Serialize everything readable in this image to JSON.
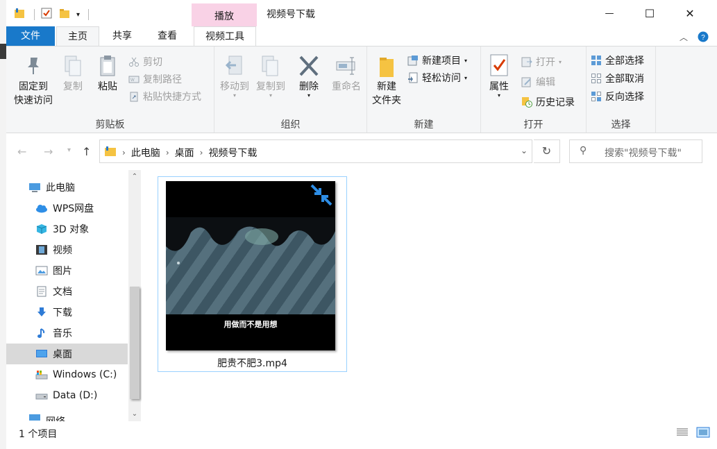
{
  "window": {
    "title": "视频号下载",
    "context_tab_group": "播放",
    "controls": {
      "minimize": "—",
      "maximize": "☐",
      "close": "✕"
    }
  },
  "ribbon_tabs": {
    "file": "文件",
    "home": "主页",
    "share": "共享",
    "view": "查看",
    "video_tools": "视频工具"
  },
  "ribbon": {
    "clipboard": {
      "label": "剪贴板",
      "pin_line1": "固定到",
      "pin_line2": "快速访问",
      "copy": "复制",
      "paste": "粘贴",
      "cut": "剪切",
      "copy_path": "复制路径",
      "paste_shortcut": "粘贴快捷方式"
    },
    "organize": {
      "label": "组织",
      "move_to": "移动到",
      "copy_to": "复制到",
      "delete": "删除",
      "rename": "重命名"
    },
    "new": {
      "label": "新建",
      "new_folder_line1": "新建",
      "new_folder_line2": "文件夹",
      "new_item": "新建项目",
      "easy_access": "轻松访问"
    },
    "open": {
      "label": "打开",
      "properties": "属性",
      "open": "打开",
      "edit": "编辑",
      "history": "历史记录"
    },
    "select": {
      "label": "选择",
      "select_all": "全部选择",
      "select_none": "全部取消",
      "invert": "反向选择"
    }
  },
  "address": {
    "crumbs": [
      "此电脑",
      "桌面",
      "视频号下载"
    ],
    "search_placeholder": "搜索\"视频号下载\""
  },
  "nav_pane": {
    "items": [
      {
        "label": "此电脑",
        "icon": "computer-icon"
      },
      {
        "label": "WPS网盘",
        "icon": "cloud-icon"
      },
      {
        "label": "3D 对象",
        "icon": "cube-icon"
      },
      {
        "label": "视频",
        "icon": "film-icon"
      },
      {
        "label": "图片",
        "icon": "picture-icon"
      },
      {
        "label": "文档",
        "icon": "document-icon"
      },
      {
        "label": "下载",
        "icon": "download-icon"
      },
      {
        "label": "音乐",
        "icon": "music-icon"
      },
      {
        "label": "桌面",
        "icon": "desktop-icon"
      },
      {
        "label": "Windows (C:)",
        "icon": "drive-icon"
      },
      {
        "label": "Data (D:)",
        "icon": "drive-icon"
      },
      {
        "label": "网络",
        "icon": "network-icon"
      }
    ]
  },
  "files": [
    {
      "name": "肥贵不肥3.mp4",
      "thumbnail_caption": "用做而不是用想"
    }
  ],
  "status": {
    "item_count": "1 个项目"
  },
  "colors": {
    "accent": "#1979ca",
    "context_tab": "#f9d2e6",
    "selection_border": "#99d1ff",
    "nav_selected": "#d9d9d9"
  }
}
